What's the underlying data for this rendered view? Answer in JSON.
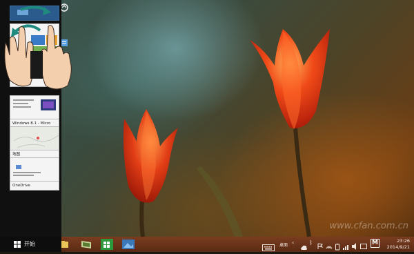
{
  "switcher": {
    "items": [
      {
        "label": "电脑设置"
      },
      {
        "label": "Windows 8.1 - Micro"
      },
      {
        "label": "地图"
      },
      {
        "label": "OneDrive"
      }
    ]
  },
  "taskbar": {
    "start_label": "开始",
    "apps": [
      {
        "icon": "file-explorer-icon"
      },
      {
        "icon": "store-icon"
      },
      {
        "icon": "photos-icon"
      }
    ],
    "tray": {
      "keyboard_icon": "keyboard-icon",
      "desktop_label": "桌面",
      "ime_label": "M",
      "time": "23:26",
      "date": "2014/9/21"
    }
  },
  "watermark": "www.cfan.com.cn",
  "colors": {
    "taskbar": "#6a3219",
    "switcher": "#101010",
    "tulip": "#e8401a",
    "store": "#2a9a3c"
  }
}
